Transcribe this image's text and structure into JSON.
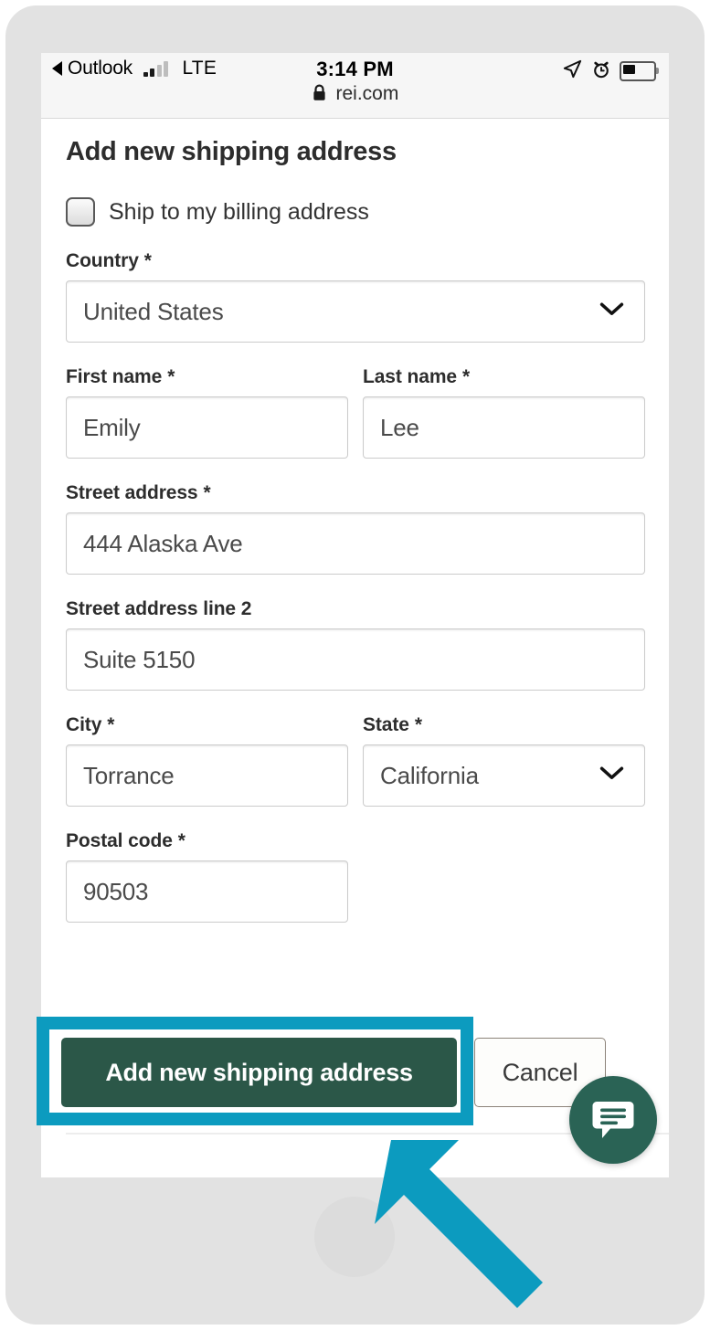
{
  "status_bar": {
    "back_label": "Outlook",
    "back_icon": "back-triangle-icon",
    "signal_icon": "signal-bars-icon",
    "network": "LTE",
    "time": "3:14 PM",
    "location_icon": "location-arrow-icon",
    "alarm_icon": "alarm-clock-icon",
    "battery_icon": "battery-icon",
    "lock_icon": "lock-icon",
    "url": "rei.com"
  },
  "form": {
    "title": "Add new shipping address",
    "billing_checkbox": {
      "label": "Ship to my billing address",
      "checked": false
    },
    "required_marker": "*",
    "fields": [
      {
        "label": "Country",
        "required": "*",
        "value": "United States",
        "type": "select"
      },
      {
        "label": "First name",
        "required": "*",
        "value": "Emily",
        "type": "text"
      },
      {
        "label": "Last name",
        "required": "*",
        "value": "Lee",
        "type": "text"
      },
      {
        "label": "Street address",
        "required": "*",
        "value": "444 Alaska Ave",
        "type": "text"
      },
      {
        "label": "Street address line 2",
        "required": "",
        "value": "Suite 5150",
        "type": "text"
      },
      {
        "label": "City",
        "required": "*",
        "value": "Torrance",
        "type": "text"
      },
      {
        "label": "State",
        "required": "*",
        "value": "California",
        "type": "select"
      },
      {
        "label": "Postal code",
        "required": "*",
        "value": "90503",
        "type": "text"
      }
    ],
    "submit_label": "Add new shipping address",
    "cancel_label": "Cancel"
  },
  "chat": {
    "icon": "chat-bubble-icon"
  },
  "annotation": {
    "highlight_target": "Add new shipping address",
    "arrow_icon": "pointer-arrow-icon"
  },
  "colors": {
    "brand_green": "#2b5748",
    "chat_green": "#2a6355",
    "highlight_cyan": "#0c9bbf",
    "frame_gray": "#e2e2e2",
    "status_bar_gray": "#f6f6f6",
    "input_border": "#cbcbcb",
    "cancel_border": "#8c8379"
  }
}
